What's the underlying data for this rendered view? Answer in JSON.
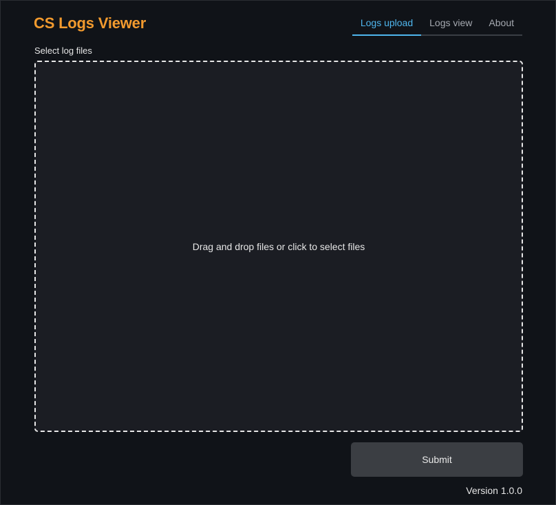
{
  "app": {
    "title": "CS Logs Viewer"
  },
  "nav": {
    "tabs": [
      {
        "label": "Logs upload",
        "active": true
      },
      {
        "label": "Logs view",
        "active": false
      },
      {
        "label": "About",
        "active": false
      }
    ]
  },
  "upload": {
    "label": "Select log files",
    "dropzone_text": "Drag and drop files or click to select files",
    "submit_label": "Submit"
  },
  "footer": {
    "version": "Version 1.0.0"
  },
  "colors": {
    "brand": "#f29a2e",
    "accent": "#4fb6ee",
    "background": "#101318",
    "dropzone_bg": "#1b1d23",
    "button_bg": "#3b3e43"
  }
}
